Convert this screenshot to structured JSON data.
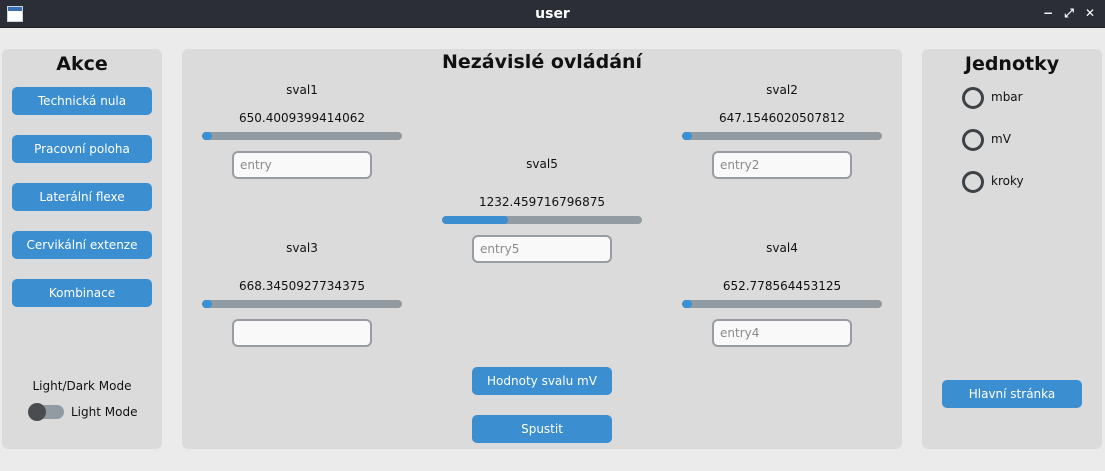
{
  "window": {
    "title": "user",
    "minimize": "−",
    "maximize": "⤢",
    "close": "✕"
  },
  "left_panel": {
    "title": "Akce",
    "buttons": [
      "Technická nula",
      "Pracovní poloha",
      "Laterální flexe",
      "Cervikální extenze",
      "Kombinace"
    ],
    "appearance_label": "Light/Dark Mode",
    "switch_label": "Light Mode",
    "switch_on": false
  },
  "center_panel": {
    "title": "Nezávislé ovládání",
    "muscles": [
      {
        "name": "sval1",
        "value": "650.4009399414062",
        "progress": 0.05,
        "entry_placeholder": "entry"
      },
      {
        "name": "sval2",
        "value": "647.1546020507812",
        "progress": 0.05,
        "entry_placeholder": "entry2"
      },
      {
        "name": "sval3",
        "value": "668.3450927734375",
        "progress": 0.05,
        "entry_placeholder": ""
      },
      {
        "name": "sval4",
        "value": "652.778564453125",
        "progress": 0.05,
        "entry_placeholder": "entry4"
      },
      {
        "name": "sval5",
        "value": "1232.459716796875",
        "progress": 0.33,
        "entry_placeholder": "entry5"
      }
    ],
    "mv_button": "Hodnoty svalu mV",
    "run_button": "Spustit"
  },
  "right_panel": {
    "title": "Jednotky",
    "radios": [
      "mbar",
      "mV",
      "kroky"
    ],
    "home_button": "Hlavní stránka"
  },
  "colors": {
    "accent": "#3b8ed0",
    "track": "#939ba2",
    "titlebar": "#2b2e37",
    "frame": "#dbdbdb"
  }
}
